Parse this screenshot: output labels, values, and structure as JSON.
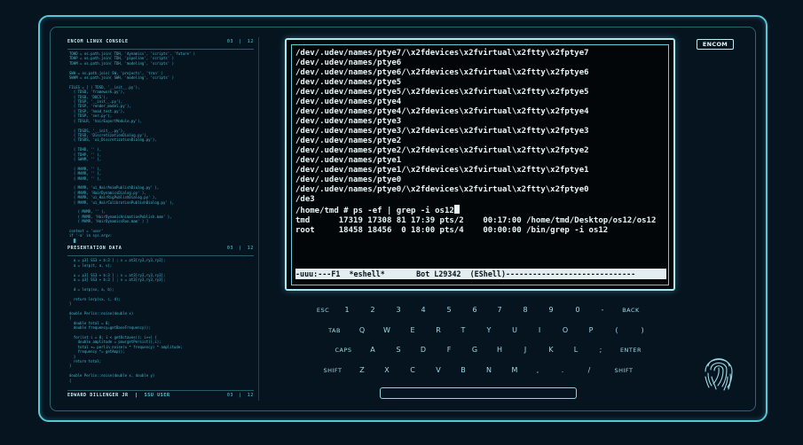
{
  "logo": "ENCOM",
  "left_panel": {
    "section1": {
      "title": "ENCOM LINUX CONSOLE",
      "page": "03",
      "total": "12"
    },
    "section2": {
      "title": "PRESENTATION DATA",
      "page": "03",
      "total": "12"
    },
    "footer": {
      "author": "EDWARD DILLENGER JR",
      "dept": "SSU USER",
      "page": "03",
      "total": "12"
    },
    "lines1": [
      "TOHD = os.path.join( TDH, 'dynamics', 'scripts', 'future' )",
      "TDHP = os.path.join( TDH, 'pipeline', 'scripts' )",
      "TDHM = os.path.join( TDH, 'modeling', 'scripts' )",
      "",
      "SWH = os.path.join( SW, 'projects', 'tron' )",
      "SWHM = os.path.join( SWH, 'modeling', 'scripts' )",
      "",
      "FILES = [ ( TDSD, '__init__.py'),",
      "  ( TDSD, 'framework.py'),",
      "  ( TDSD, 'DOCS'),",
      "  ( TDSP, '__init__.py'),",
      "  ( TDSP, 'render_model.py'),",
      "  ( TDSP, 'head_test.py'),",
      "  ( TDSP, 'ser.py'),",
      "  ( TDSLR, 'hairExportModule.py'),",
      "",
      "  ( TDSDS, '__init__.py'),",
      "  ( TDSD, 'DiscretizationDialog.py'),",
      "  ( TDSDS, 'ui_DiscretizationDialog.py'),",
      "",
      "  ( TDHD, '' ),",
      "  ( TDHP, '' ),",
      "  ( SWHM, '' ),",
      "",
      "  ( MAMR, '' ),",
      "  ( MAMR, '' ),",
      "  ( MAMR, '' ),",
      "",
      "  ( MAMR, 'ui_HairAnimPublishDialog.py' ),",
      "  ( MAMR, 'HairDynamicsDialog.py' ),",
      "  ( MAMR, 'ui_HairRigPublishDialog.py' ),",
      "  ( MAMR, 'ui_HairCalibrationPublishDialog.py' ),",
      "",
      "    ( MAMR, '' ),",
      "    ( MAMR, 'HairDynamicAnimationPublish.mam' ),",
      "    ( MAMR, 'HairDynamicsRun.mam' ) ]",
      "",
      "context = 'user'",
      "if '-a' in sys.argv:",
      "  █"
    ],
    "lines2": [
      "",
      "  a = p3[ SS3 + b:3 ] ; v = at3[ry3,ry3,ry3];",
      "  a = lerp(t, a, v);",
      "",
      "  u = p3[ SS3 + b:3 ] ; v = at3[ry3,ry3,ry3];",
      "  a = p3[ SS3 + b:3 ] ; v = at3[ry3,ry3,ry3];",
      "",
      "  d = lerp(sx, a, b);",
      "",
      "  return lerp(sx, c, d);",
      "}",
      "",
      "double Perlin::noise(double x)",
      "{",
      "  double total = 0;",
      "  double frequency=getBaseFrequency();",
      "",
      "  for(int i = 0; i < getOctaves(); i++) {",
      "    double amplitude = pow(getPersist(),i);",
      "    total += perlin_noise(x * frequency) * amplitude;",
      "    frequency *= getAmp();",
      "  }",
      "  return total;",
      "}",
      "",
      "double Perlin::noise(double x, double y)",
      "{"
    ]
  },
  "terminal": {
    "lines": [
      "/dev/.udev/names/ptye7/\\x2fdevices\\x2fvirtual\\x2ftty\\x2fptye7",
      "/dev/.udev/names/ptye6",
      "/dev/.udev/names/ptye6/\\x2fdevices\\x2fvirtual\\x2ftty\\x2fptye6",
      "/dev/.udev/names/ptye5",
      "/dev/.udev/names/ptye5/\\x2fdevices\\x2fvirtual\\x2ftty\\x2fptye5",
      "/dev/.udev/names/ptye4",
      "/dev/.udev/names/ptye4/\\x2fdevices\\x2fvirtual\\x2ftty\\x2fptye4",
      "/dev/.udev/names/ptye3",
      "/dev/.udev/names/ptye3/\\x2fdevices\\x2fvirtual\\x2ftty\\x2fptye3",
      "/dev/.udev/names/ptye2",
      "/dev/.udev/names/ptye2/\\x2fdevices\\x2fvirtual\\x2ftty\\x2fptye2",
      "/dev/.udev/names/ptye1",
      "/dev/.udev/names/ptye1/\\x2fdevices\\x2fvirtual\\x2ftty\\x2fptye1",
      "/dev/.udev/names/ptye0",
      "/dev/.udev/names/ptye0/\\x2fdevices\\x2fvirtual\\x2ftty\\x2fptye0",
      "/de3"
    ],
    "prompt": "/home/tmd # ps -ef | grep -i os12",
    "processes": [
      "tmd      17319 17308 81 17:39 pts/2    00:17:00 /home/tmd/Desktop/os12/os12",
      "root     18458 18456  0 18:00 pts/4    00:00:00 /bin/grep -i os12"
    ],
    "modeline": "-uuu:---F1  *eshell*       Bot L29342  (EShell)-----------------------------"
  },
  "keyboard": {
    "row1": [
      "ESC",
      "1",
      "2",
      "3",
      "4",
      "5",
      "6",
      "7",
      "8",
      "9",
      "0",
      "-",
      "BACK"
    ],
    "row2": [
      "TAB",
      "Q",
      "W",
      "E",
      "R",
      "T",
      "Y",
      "U",
      "I",
      "O",
      "P",
      "(",
      ")"
    ],
    "row3": [
      "CAPS",
      "A",
      "S",
      "D",
      "F",
      "G",
      "H",
      "J",
      "K",
      "L",
      ";",
      "ENTER"
    ],
    "row4": [
      "SHIFT",
      "Z",
      "X",
      "C",
      "V",
      "B",
      "N",
      "M",
      ",",
      ".",
      "/",
      "SHIFT"
    ]
  }
}
